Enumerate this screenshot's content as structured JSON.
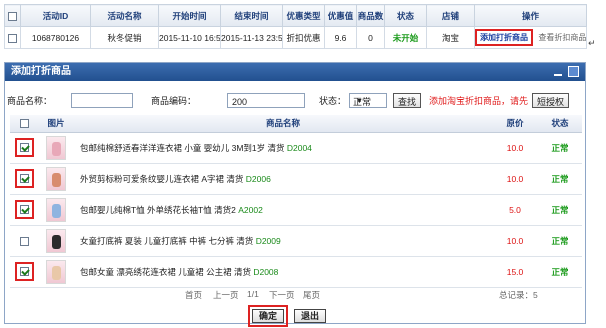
{
  "top_table": {
    "headers": [
      "活动ID",
      "活动名称",
      "开始时间",
      "结束时间",
      "优惠类型",
      "优惠值",
      "商品数",
      "状态",
      "店铺",
      "操作"
    ],
    "row": {
      "id": "1068780126",
      "name": "秋冬促销",
      "start": "2015-11-10 16:50",
      "end": "2015-11-13 23:59",
      "type": "折扣优惠",
      "value": "9.6",
      "count": "0",
      "status": "未开始",
      "shop": "淘宝",
      "add_btn": "添加打折商品",
      "view_link": "查看折扣商品"
    },
    "enter_mark": "↵"
  },
  "dialog": {
    "title": "添加打折商品",
    "search": {
      "name_label": "商品名称：",
      "name_value": "",
      "code_label": "商品编码：",
      "code_value": "200",
      "status_label": "状态：",
      "status_value": "正常",
      "search_btn": "查找",
      "hint": "添加淘宝折扣商品，请先",
      "sync_btn": "短授权"
    },
    "headers": {
      "pic": "图片",
      "name": "商品名称",
      "price": "原价",
      "status": "状态"
    },
    "rows": [
      {
        "checked": true,
        "name": "包邮纯棉舒适春洋洋连衣裙 小童 婴幼儿 3M到1岁 清货",
        "code": "D2004",
        "price": "10.0",
        "status": "正常",
        "thumb_color": "#e8a8b8"
      },
      {
        "checked": true,
        "name": "外贸剪标粉可爱条纹婴儿连衣裙 A字裙 清货",
        "code": "D2006",
        "price": "10.0",
        "status": "正常",
        "thumb_color": "#d88c6e"
      },
      {
        "checked": true,
        "name": "包邮婴儿纯棉T恤 外单绣花长袖T恤 清货2",
        "code": "A2002",
        "price": "5.0",
        "status": "正常",
        "thumb_color": "#8fb4e0"
      },
      {
        "checked": false,
        "name": "女童打底裤 夏装 儿童打底裤 中裤 七分裤 清货",
        "code": "D2009",
        "price": "10.0",
        "status": "正常",
        "thumb_color": "#2b2b2b"
      },
      {
        "checked": true,
        "name": "包邮女童 漂亮绣花连衣裙 儿童裙 公主裙 清货",
        "code": "D2008",
        "price": "15.0",
        "status": "正常",
        "thumb_color": "#e9c8a8"
      }
    ],
    "pager": {
      "first": "首页",
      "prev": "上一页",
      "page": "1/1",
      "next": "下一页",
      "last": "尾页",
      "total": "总记录：5"
    },
    "ok_btn": "确定",
    "cancel_btn": "退出"
  }
}
